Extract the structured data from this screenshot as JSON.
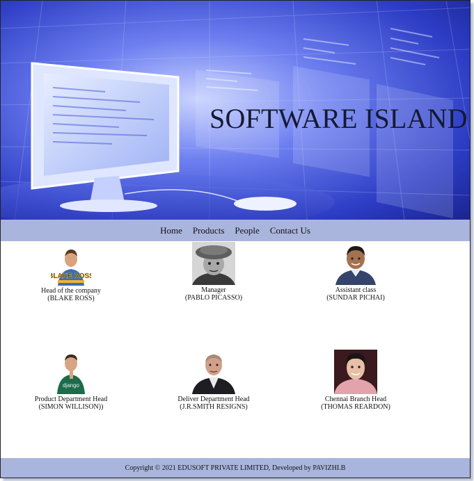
{
  "hero": {
    "title": "SOFTWARE ISLAND"
  },
  "nav": {
    "items": [
      "Home",
      "Products",
      "People",
      "Contact Us"
    ]
  },
  "people": [
    {
      "role": "Head of the company",
      "name": "(BLAKE ROSS)",
      "badge": "BLAKE ROSS"
    },
    {
      "role": "Manager",
      "name": "(PABLO PICASSO)"
    },
    {
      "role": "Assistant class",
      "name": "(SUNDAR PICHAI)"
    },
    {
      "role": "Product Department Head",
      "name": "(SIMON WILLISON))",
      "shirt_text": "django"
    },
    {
      "role": "Deliver Department Head",
      "name": "(J.R.SMITH RESIGNS)"
    },
    {
      "role": "Chennai Branch Head",
      "name": "(THOMAS REARDON)"
    }
  ],
  "footer": {
    "text": "Copyright © 2021 EDUSOFT PRIVATE LIMITED, Developed by PAVIZHI.B"
  },
  "colors": {
    "nav_bg": "#aab5dd",
    "footer_bg": "#aab5dd",
    "hero_blue": "#3a4fd6"
  }
}
